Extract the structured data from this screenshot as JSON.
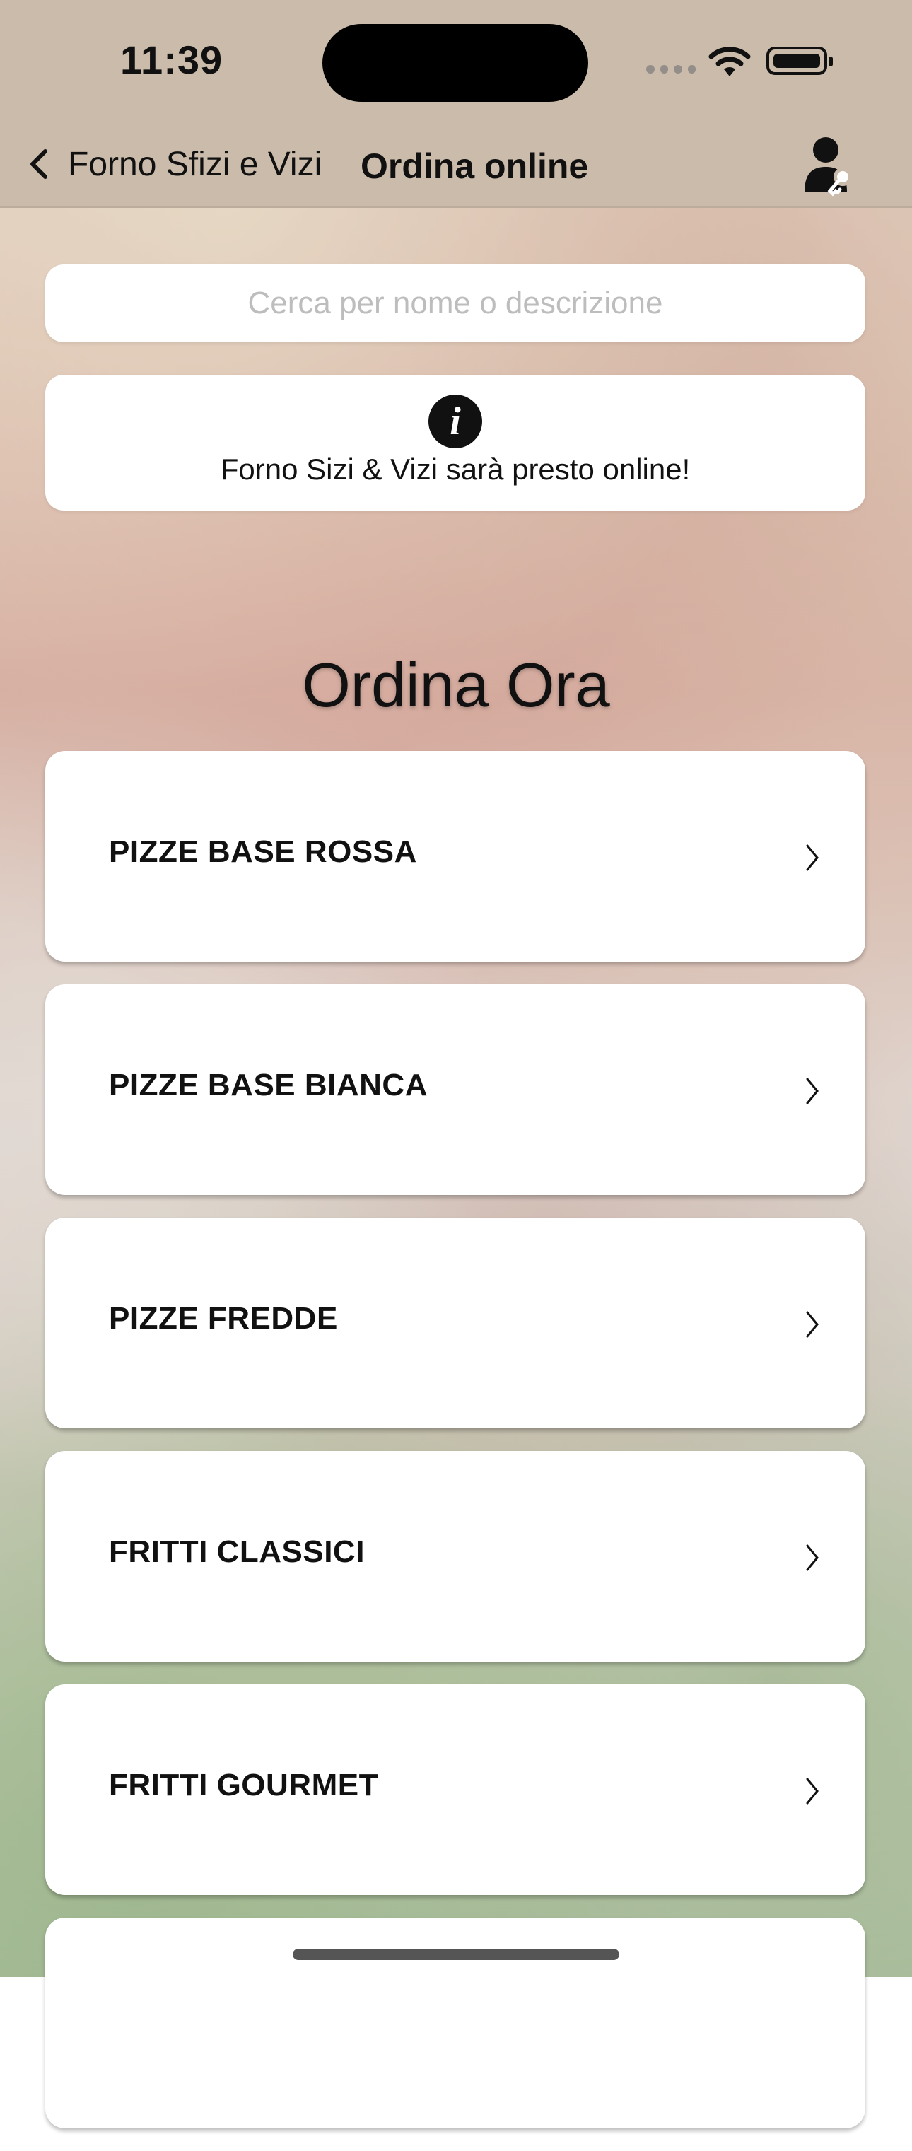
{
  "status_bar": {
    "time": "11:39"
  },
  "navbar": {
    "back_label": "Forno Sfizi e Vizi",
    "title": "Ordina online"
  },
  "search": {
    "placeholder": "Cerca per nome o descrizione"
  },
  "info": {
    "message": "Forno Sizi & Vizi sarà presto online!"
  },
  "section": {
    "title": "Ordina Ora"
  },
  "menu": {
    "items": [
      {
        "label": "PIZZE BASE ROSSA"
      },
      {
        "label": "PIZZE BASE BIANCA"
      },
      {
        "label": "PIZZE FREDDE"
      },
      {
        "label": "FRITTI CLASSICI"
      },
      {
        "label": "FRITTI GOURMET"
      },
      {
        "label": ""
      }
    ]
  }
}
